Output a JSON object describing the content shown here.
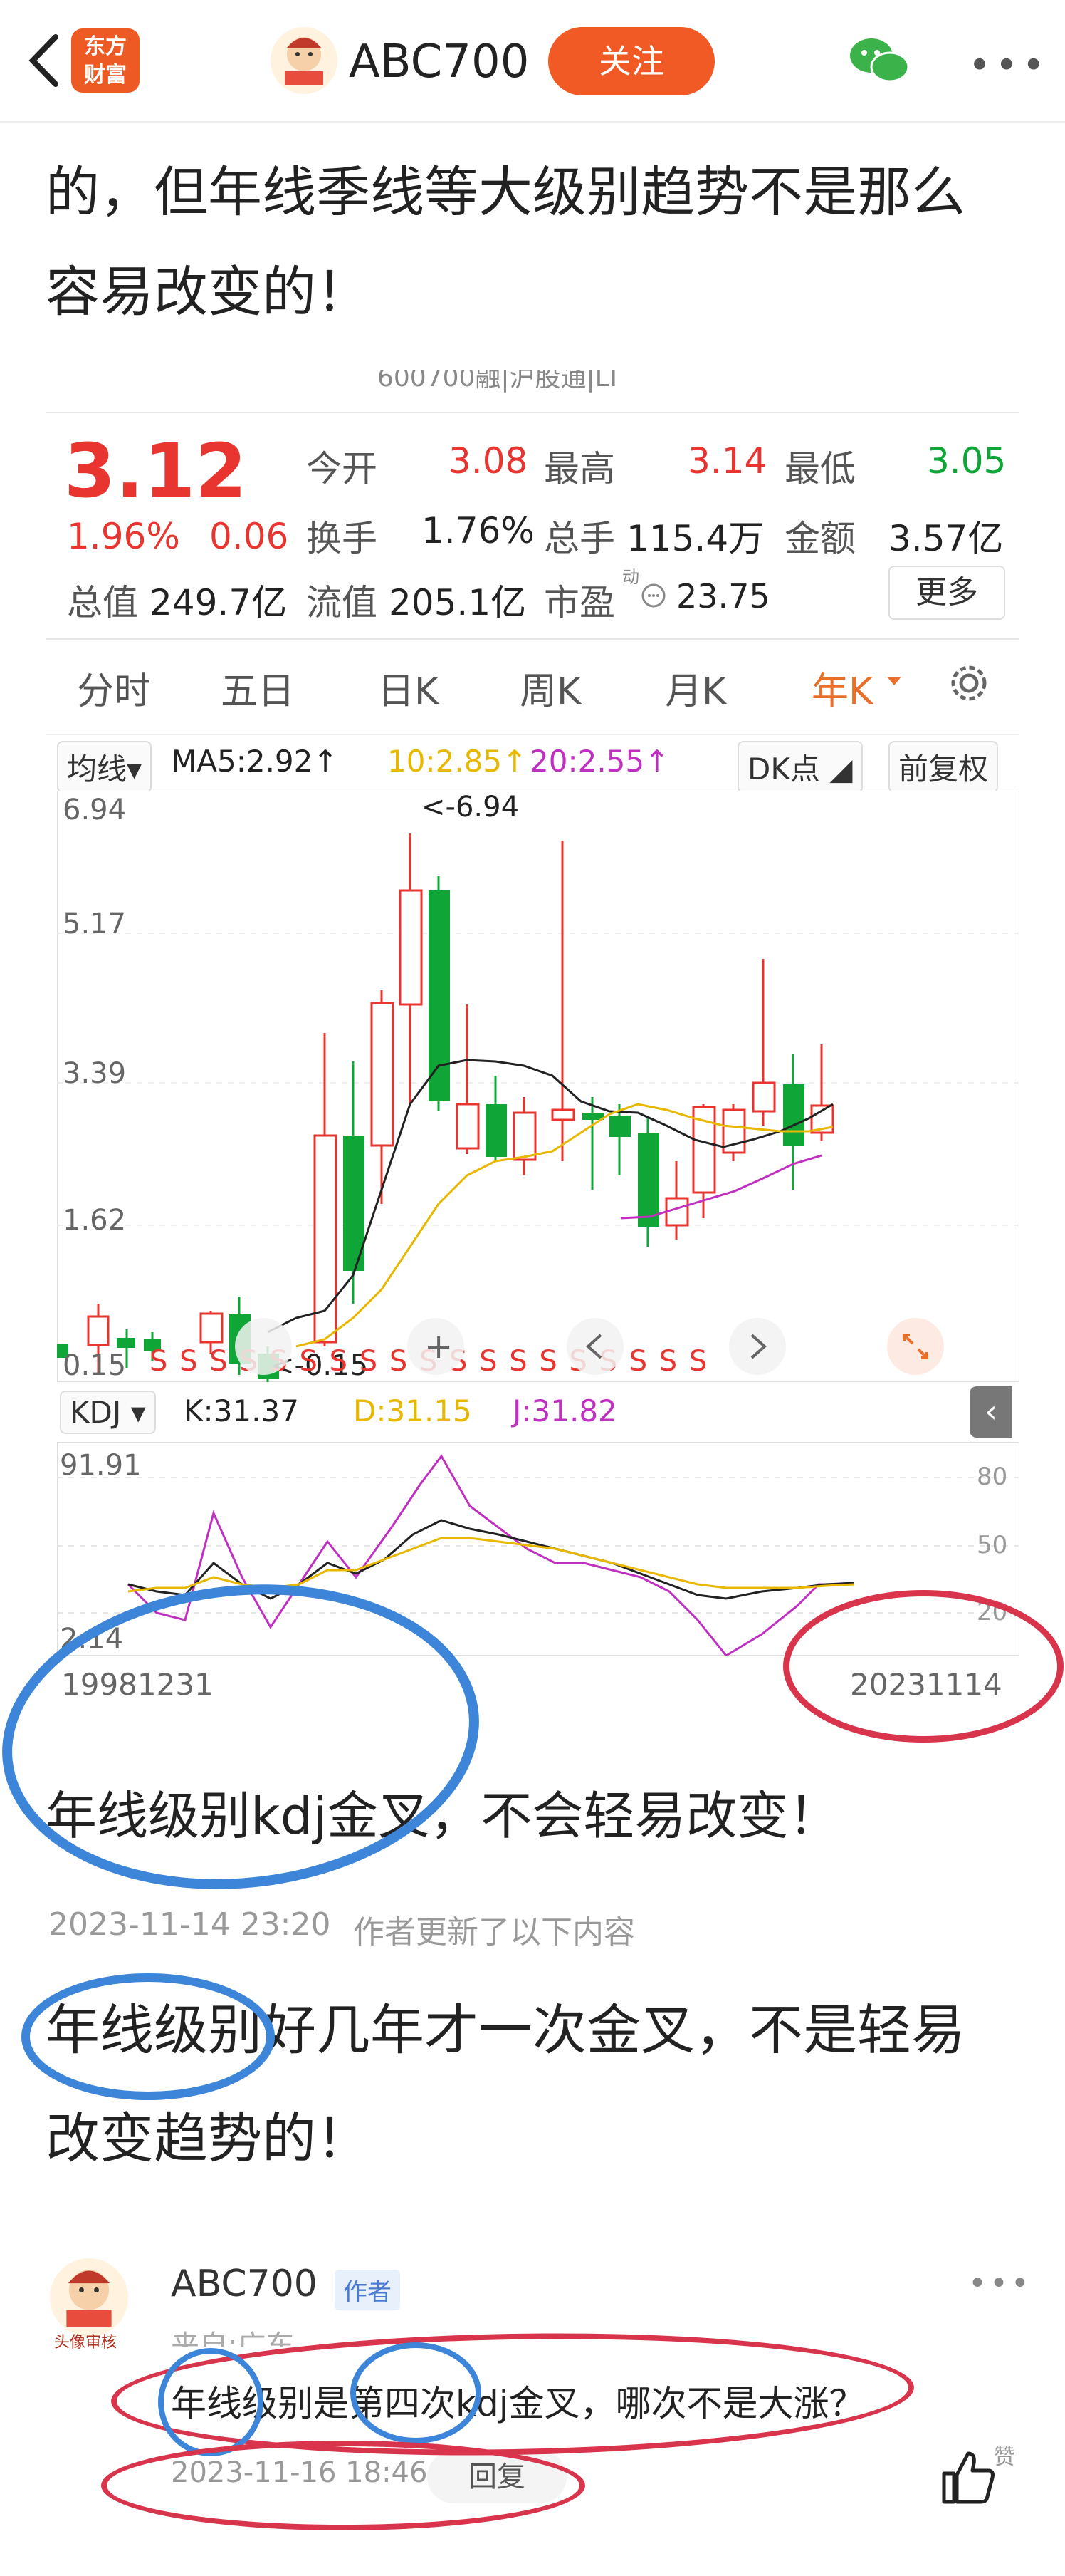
{
  "header": {
    "logo_line1": "东方",
    "logo_line2": "财富",
    "username": "ABC700",
    "follow_label": "关注",
    "more_icon": "•••",
    "avatar_caption": "头像审核"
  },
  "post": {
    "intro_line1": "的，但年线季线等大级别趋势不是那么",
    "intro_line2": "容易改变的！",
    "cut_header": "600700融|沪股通|LT"
  },
  "quote": {
    "price": "3.12",
    "change_pct": "1.96%",
    "change": "0.06",
    "stats": [
      {
        "label": "今开",
        "value": "3.08",
        "color": "red"
      },
      {
        "label": "最高",
        "value": "3.14",
        "color": "red"
      },
      {
        "label": "最低",
        "value": "3.05",
        "color": "green"
      },
      {
        "label": "换手",
        "value": "1.76%",
        "color": "dark"
      },
      {
        "label": "总手",
        "value": "115.4万",
        "color": "dark"
      },
      {
        "label": "金额",
        "value": "3.57亿",
        "color": "dark"
      },
      {
        "label": "总值",
        "value": "249.7亿",
        "color": "dark"
      },
      {
        "label": "流值",
        "value": "205.1亿",
        "color": "dark"
      },
      {
        "label": "市盈",
        "value": "23.75",
        "color": "dark"
      }
    ],
    "pe_superscript": "动",
    "more_label": "更多"
  },
  "tabs": [
    "分时",
    "五日",
    "日K",
    "周K",
    "月K",
    "年K"
  ],
  "chart": {
    "ma_selector": "均线",
    "ma5": "MA5:2.92",
    "ma10": "10:2.85",
    "ma20": "20:2.55",
    "arrow": "↑",
    "dk_label": "DK点",
    "adjust_label": "前复权",
    "y_ticks": [
      "6.94",
      "5.17",
      "3.39",
      "1.62",
      "0.15"
    ],
    "max_label": "<-6.94",
    "min_label": "<-0.15",
    "s_marks": "S S S S S S S S S S S S S S S S S S S",
    "kdj_selector": "KDJ",
    "k": "K:31.37",
    "d": "D:31.15",
    "j": "J:31.82",
    "kdj_left_ticks": [
      "91.91",
      "2.14"
    ],
    "kdj_right_ticks": [
      "80",
      "50",
      "20"
    ],
    "start_date": "19981231",
    "end_date": "20231114",
    "colors": {
      "up": "#e8352f",
      "down": "#10a537",
      "ma5": "#222222",
      "ma10": "#e8c020",
      "ma20": "#c030c0"
    }
  },
  "annotation": "年线级别kdj金叉，不会轻易改变！",
  "update": {
    "time": "2023-11-14 23:20",
    "note": "作者更新了以下内容"
  },
  "update_text_line1": "年线级别好几年才一次金叉，不是轻易",
  "update_text_line2": "改变趋势的！",
  "comment": {
    "author": "ABC700",
    "badge": "作者",
    "source": "来自:广东",
    "text": "年线级别是第四次kdj金叉，哪次不是大涨？",
    "time": "2023-11-16 18:46",
    "reply": "回复",
    "like": "赞"
  }
}
